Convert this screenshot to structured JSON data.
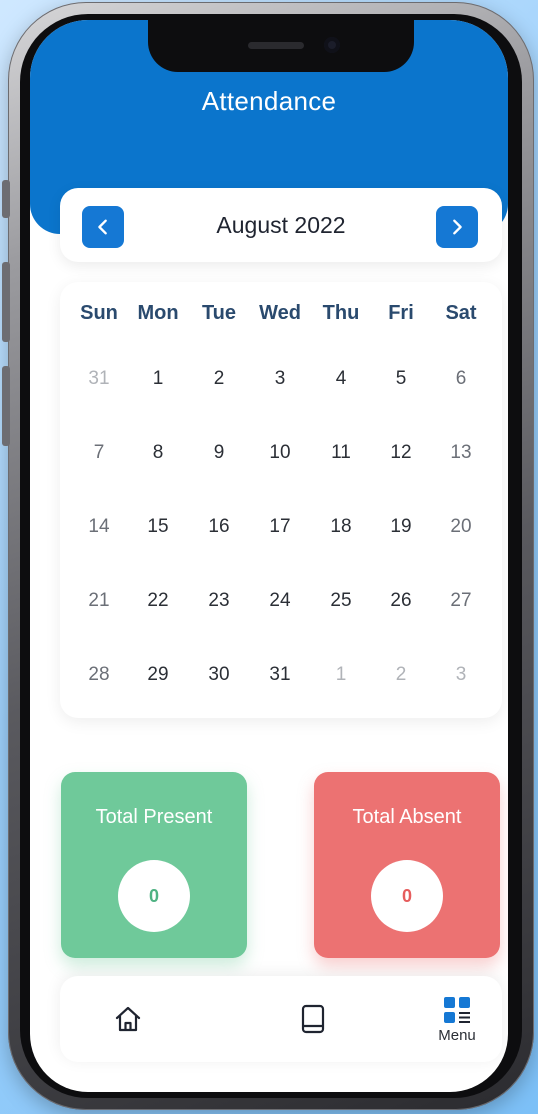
{
  "header": {
    "title": "Attendance"
  },
  "month_selector": {
    "label": "August 2022",
    "prev_icon": "chevron-left-icon",
    "next_icon": "chevron-right-icon"
  },
  "calendar": {
    "weekdays": [
      "Sun",
      "Mon",
      "Tue",
      "Wed",
      "Thu",
      "Fri",
      "Sat"
    ],
    "weeks": [
      [
        {
          "d": "31",
          "m": true
        },
        {
          "d": "1"
        },
        {
          "d": "2"
        },
        {
          "d": "3"
        },
        {
          "d": "4"
        },
        {
          "d": "5"
        },
        {
          "d": "6",
          "w": true
        }
      ],
      [
        {
          "d": "7",
          "w": true
        },
        {
          "d": "8"
        },
        {
          "d": "9"
        },
        {
          "d": "10"
        },
        {
          "d": "11"
        },
        {
          "d": "12"
        },
        {
          "d": "13",
          "w": true
        }
      ],
      [
        {
          "d": "14",
          "w": true
        },
        {
          "d": "15"
        },
        {
          "d": "16"
        },
        {
          "d": "17"
        },
        {
          "d": "18"
        },
        {
          "d": "19"
        },
        {
          "d": "20",
          "w": true
        }
      ],
      [
        {
          "d": "21",
          "w": true
        },
        {
          "d": "22"
        },
        {
          "d": "23"
        },
        {
          "d": "24"
        },
        {
          "d": "25"
        },
        {
          "d": "26"
        },
        {
          "d": "27",
          "w": true
        }
      ],
      [
        {
          "d": "28",
          "w": true
        },
        {
          "d": "29"
        },
        {
          "d": "30"
        },
        {
          "d": "31"
        },
        {
          "d": "1",
          "m": true
        },
        {
          "d": "2",
          "m": true
        },
        {
          "d": "3",
          "m": true
        }
      ]
    ]
  },
  "stats": {
    "present": {
      "label": "Total Present",
      "value": "0",
      "color": "#6fc99a"
    },
    "absent": {
      "label": "Total Absent",
      "value": "0",
      "color": "#ec7272"
    }
  },
  "bottom_nav": {
    "items": [
      {
        "icon": "home-icon"
      },
      {
        "icon": "book-icon"
      },
      {
        "icon": "menu-grid-icon",
        "label": "Menu"
      }
    ]
  },
  "colors": {
    "primary": "#0b75cc",
    "button": "#1578d4"
  }
}
